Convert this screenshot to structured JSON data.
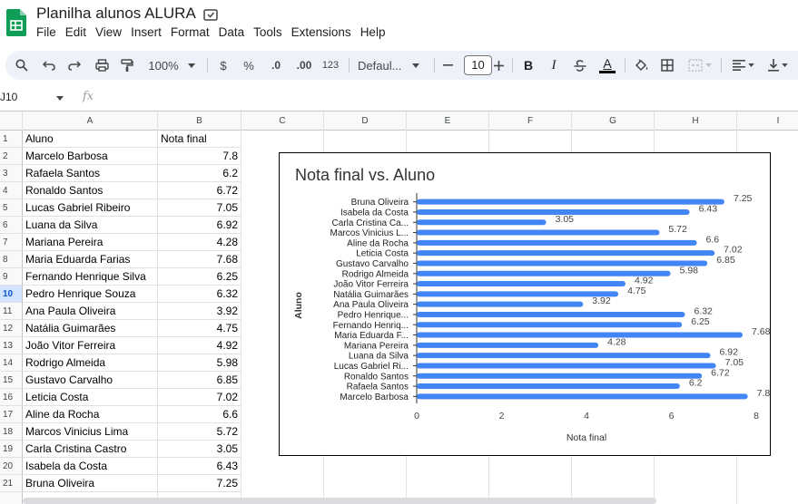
{
  "app": {
    "doc_title": "Planilha alunos ALURA",
    "menu": [
      "File",
      "Edit",
      "View",
      "Insert",
      "Format",
      "Data",
      "Tools",
      "Extensions",
      "Help"
    ]
  },
  "toolbar": {
    "zoom": "100%",
    "currency": "$",
    "percent": "%",
    "decrease_decimal": ".0",
    "increase_decimal": ".00",
    "number_format": "123",
    "font_family": "Defaul...",
    "font_size": "10",
    "bold": "B",
    "italic": "I",
    "text_color": "A"
  },
  "formula_bar": {
    "cell_ref": "J10",
    "fx": "fx"
  },
  "sheet": {
    "columns": [
      "A",
      "B",
      "C",
      "D",
      "E",
      "F",
      "G",
      "H",
      "I"
    ],
    "selected_row": 10,
    "rows": [
      {
        "n": "1",
        "a": "Aluno",
        "b": "Nota final"
      },
      {
        "n": "2",
        "a": "Marcelo Barbosa",
        "b": "7.8"
      },
      {
        "n": "3",
        "a": "Rafaela Santos",
        "b": "6.2"
      },
      {
        "n": "4",
        "a": "Ronaldo Santos",
        "b": "6.72"
      },
      {
        "n": "5",
        "a": "Lucas Gabriel Ribeiro",
        "b": "7.05"
      },
      {
        "n": "6",
        "a": "Luana da Silva",
        "b": "6.92"
      },
      {
        "n": "7",
        "a": "Mariana Pereira",
        "b": "4.28"
      },
      {
        "n": "8",
        "a": "Maria Eduarda Farias",
        "b": "7.68"
      },
      {
        "n": "9",
        "a": "Fernando Henrique Silva",
        "b": "6.25"
      },
      {
        "n": "10",
        "a": "Pedro Henrique Souza",
        "b": "6.32"
      },
      {
        "n": "11",
        "a": "Ana Paula Oliveira",
        "b": "3.92"
      },
      {
        "n": "12",
        "a": "Natália Guimarães",
        "b": "4.75"
      },
      {
        "n": "13",
        "a": "João Vitor Ferreira",
        "b": "4.92"
      },
      {
        "n": "14",
        "a": "Rodrigo Almeida",
        "b": "5.98"
      },
      {
        "n": "15",
        "a": "Gustavo Carvalho",
        "b": "6.85"
      },
      {
        "n": "16",
        "a": "Leticia Costa",
        "b": "7.02"
      },
      {
        "n": "17",
        "a": "Aline da Rocha",
        "b": "6.6"
      },
      {
        "n": "18",
        "a": "Marcos Vinicius Lima",
        "b": "5.72"
      },
      {
        "n": "19",
        "a": "Carla Cristina Castro",
        "b": "3.05"
      },
      {
        "n": "20",
        "a": "Isabela da Costa",
        "b": "6.43"
      },
      {
        "n": "21",
        "a": "Bruna Oliveira",
        "b": "7.25"
      }
    ]
  },
  "chart_data": {
    "type": "bar",
    "orientation": "horizontal",
    "title": "Nota final vs. Aluno",
    "xlabel": "Nota final",
    "ylabel": "Aluno",
    "xlim": [
      0,
      8
    ],
    "xticks": [
      "0",
      "2",
      "4",
      "6",
      "8"
    ],
    "grid": false,
    "bar_color": "#4285f4",
    "categories": [
      "Bruna Oliveira",
      "Isabela da Costa",
      "Carla Cristina Ca...",
      "Marcos Vinicius L...",
      "Aline da Rocha",
      "Leticia Costa",
      "Gustavo Carvalho",
      "Rodrigo Almeida",
      "João Vitor Ferreira",
      "Natália Guimarães",
      "Ana Paula Oliveira",
      "Pedro Henrique...",
      "Fernando Henriq...",
      "Maria Eduarda F...",
      "Mariana Pereira",
      "Luana da Silva",
      "Lucas Gabriel Ri...",
      "Ronaldo Santos",
      "Rafaela Santos",
      "Marcelo Barbosa"
    ],
    "values": [
      7.25,
      6.43,
      3.05,
      5.72,
      6.6,
      7.02,
      6.85,
      5.98,
      4.92,
      4.75,
      3.92,
      6.32,
      6.25,
      7.68,
      4.28,
      6.92,
      7.05,
      6.72,
      6.2,
      7.8
    ],
    "value_labels": [
      "7.25",
      "6.43",
      "3.05",
      "5.72",
      "6.6",
      "7.02",
      "6.85",
      "5.98",
      "4.92",
      "4.75",
      "3.92",
      "6.32",
      "6.25",
      "7.68",
      "4.28",
      "6.92",
      "7.05",
      "6.72",
      "6.2",
      "7.8"
    ]
  }
}
